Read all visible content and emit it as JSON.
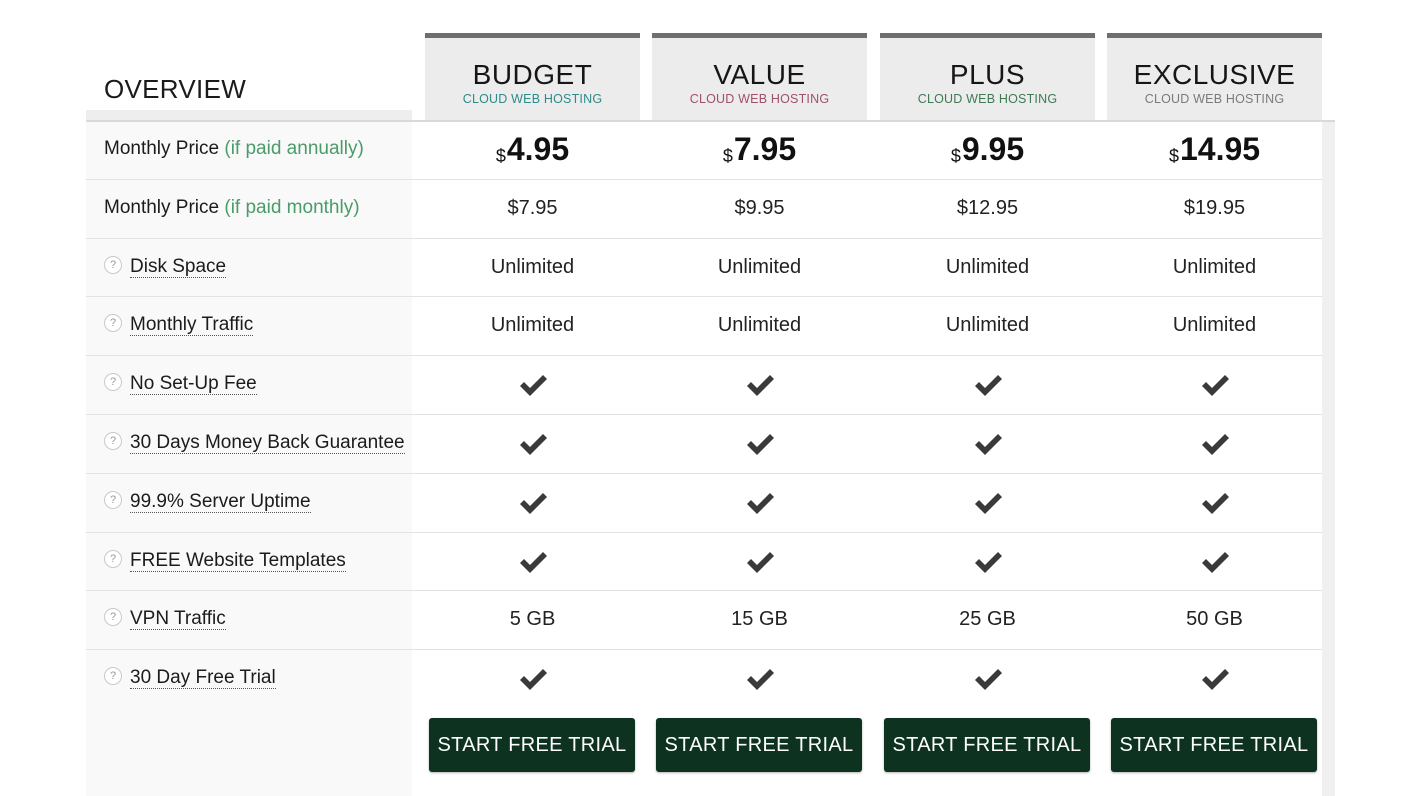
{
  "overview": {
    "title": "OVERVIEW",
    "rows": [
      {
        "label": "Monthly Price",
        "note": "(if paid annually)",
        "help": false
      },
      {
        "label": "Monthly Price",
        "note": "(if paid monthly)",
        "help": false
      },
      {
        "label": "Disk Space",
        "help": true
      },
      {
        "label": "Monthly Traffic",
        "help": true
      },
      {
        "label": "No Set-Up Fee",
        "help": true
      },
      {
        "label": "30 Days Money Back Guarantee",
        "help": true
      },
      {
        "label": "99.9% Server Uptime",
        "help": true
      },
      {
        "label": "FREE Website Templates",
        "help": true
      },
      {
        "label": "VPN Traffic",
        "help": true
      },
      {
        "label": "30 Day Free Trial",
        "help": true
      }
    ],
    "help_glyph": "?"
  },
  "plans": [
    {
      "name": "BUDGET",
      "subtitle": "CLOUD WEB HOSTING",
      "subtitle_color": "#2f8a8a",
      "currency": "$",
      "annual_price": "4.95",
      "monthly_price": "$7.95",
      "disk_space": "Unlimited",
      "traffic": "Unlimited",
      "no_setup_fee": true,
      "money_back": true,
      "uptime": true,
      "templates": true,
      "vpn_traffic": "5 GB",
      "free_trial": true,
      "button": "START FREE TRIAL"
    },
    {
      "name": "VALUE",
      "subtitle": "CLOUD WEB HOSTING",
      "subtitle_color": "#a0506e",
      "currency": "$",
      "annual_price": "7.95",
      "monthly_price": "$9.95",
      "disk_space": "Unlimited",
      "traffic": "Unlimited",
      "no_setup_fee": true,
      "money_back": true,
      "uptime": true,
      "templates": true,
      "vpn_traffic": "15 GB",
      "free_trial": true,
      "button": "START FREE TRIAL"
    },
    {
      "name": "PLUS",
      "subtitle": "CLOUD WEB HOSTING",
      "subtitle_color": "#3e7a52",
      "currency": "$",
      "annual_price": "9.95",
      "monthly_price": "$12.95",
      "disk_space": "Unlimited",
      "traffic": "Unlimited",
      "no_setup_fee": true,
      "money_back": true,
      "uptime": true,
      "templates": true,
      "vpn_traffic": "25 GB",
      "free_trial": true,
      "button": "START FREE TRIAL"
    },
    {
      "name": "EXCLUSIVE",
      "subtitle": "CLOUD WEB HOSTING",
      "subtitle_color": "#7a7a7a",
      "currency": "$",
      "annual_price": "14.95",
      "monthly_price": "$19.95",
      "disk_space": "Unlimited",
      "traffic": "Unlimited",
      "no_setup_fee": true,
      "money_back": true,
      "uptime": true,
      "templates": true,
      "vpn_traffic": "50 GB",
      "free_trial": true,
      "button": "START FREE TRIAL"
    }
  ],
  "colors": {
    "button_bg": "#0d3320",
    "note_green": "#4a9b6a",
    "check": "#3a3a3a",
    "header_top_border": "#6e6e6e"
  },
  "icons": {
    "check": "check-icon",
    "help": "help-icon"
  }
}
